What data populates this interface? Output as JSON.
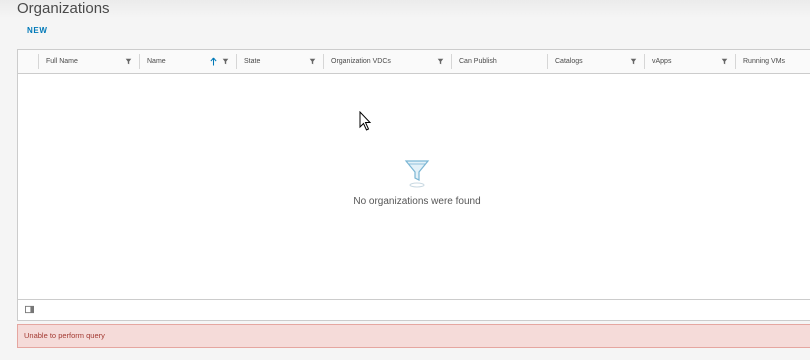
{
  "page": {
    "title": "Organizations"
  },
  "toolbar": {
    "new_label": "NEW"
  },
  "grid": {
    "columns": [
      {
        "label": "Full Name",
        "filter": true,
        "sort": null
      },
      {
        "label": "Name",
        "filter": true,
        "sort": "ascending"
      },
      {
        "label": "State",
        "filter": true,
        "sort": null
      },
      {
        "label": "Organization VDCs",
        "filter": true,
        "sort": null
      },
      {
        "label": "Can Publish",
        "filter": false,
        "sort": null
      },
      {
        "label": "Catalogs",
        "filter": true,
        "sort": null
      },
      {
        "label": "vApps",
        "filter": true,
        "sort": null
      },
      {
        "label": "Running VMs",
        "filter": false,
        "sort": null
      }
    ],
    "empty_message": "No organizations were found",
    "empty_icon": "funnel-icon",
    "footer_icon": "column-toggle-icon"
  },
  "alert": {
    "type": "danger",
    "message": "Unable to perform query"
  },
  "colors": {
    "accent": "#0079b8",
    "error_bg": "#f5dbd9",
    "error_text": "#a33a32"
  }
}
